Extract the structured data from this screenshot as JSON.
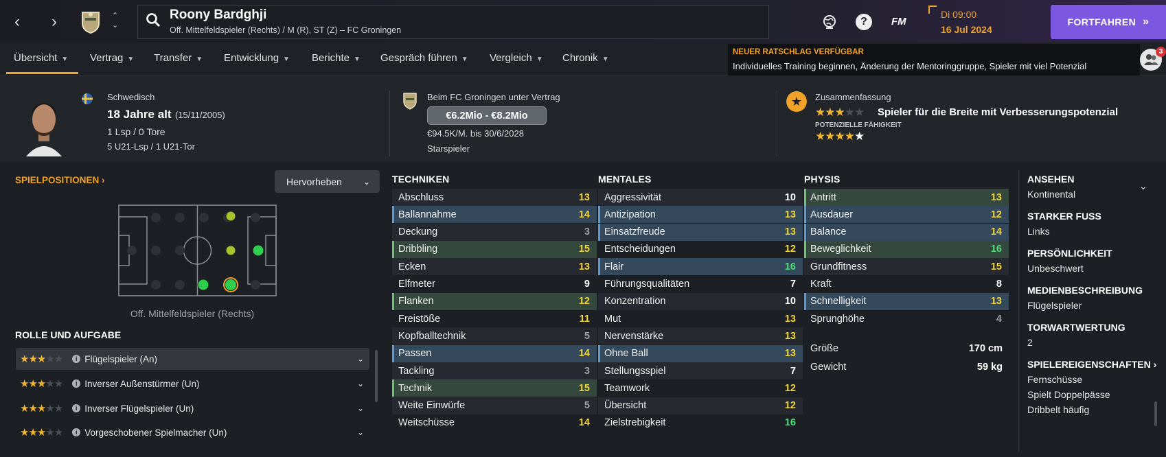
{
  "header": {
    "player_name": "Roony Bardghji",
    "player_subtitle": "Off. Mittelfeldspieler (Rechts) / M (R), ST (Z) – FC Groningen",
    "day_time": "Di 09:00",
    "date": "16 Jul 2024",
    "continue_label": "FORTFAHREN",
    "fm_label": "FM"
  },
  "tabs": [
    "Übersicht",
    "Vertrag",
    "Transfer",
    "Entwicklung",
    "Berichte",
    "Gespräch führen",
    "Vergleich",
    "Chronik"
  ],
  "notice": {
    "title": "NEUER RATSCHLAG VERFÜGBAR",
    "text": "Individuelles Training beginnen, Änderung der Mentoringgruppe, Spieler mit viel Potenzial",
    "badge": "3"
  },
  "profile": {
    "nationality": "Schwedisch",
    "age": "18 Jahre alt",
    "dob": "(15/11/2005)",
    "caps": "1 Lsp / 0 Tore",
    "youth_caps": "5 U21-Lsp / 1 U21-Tor"
  },
  "contract": {
    "club_line": "Beim FC Groningen unter Vertrag",
    "value": "€6.2Mio - €8.2Mio",
    "wage": "€94.5K/M. bis 30/6/2028",
    "status": "Starspieler"
  },
  "summary": {
    "title": "Zusammenfassung",
    "description": "Spieler für die Breite mit Verbesserungspotenzial",
    "potential_label": "POTENZIELLE FÄHIGKEIT",
    "current_stars": 3,
    "potential_stars": 4
  },
  "positions": {
    "title": "SPIELPOSITIONEN",
    "highlight_label": "Hervorheben",
    "caption": "Off. Mittelfeldspieler (Rechts)",
    "role_title": "ROLLE UND AUFGABE",
    "roles": [
      {
        "stars": 3,
        "label": "Flügelspieler (An)"
      },
      {
        "stars": 3,
        "label": "Inverser Außenstürmer (Un)"
      },
      {
        "stars": 3,
        "label": "Inverser Flügelspieler (Un)"
      },
      {
        "stars": 3,
        "label": "Vorgeschobener Spielmacher (Un)"
      }
    ]
  },
  "attributes": {
    "techniken_title": "TECHNIKEN",
    "mentales_title": "MENTALES",
    "physis_title": "PHYSIS",
    "techniken": [
      {
        "name": "Abschluss",
        "value": "13"
      },
      {
        "name": "Ballannahme",
        "value": "14"
      },
      {
        "name": "Deckung",
        "value": "3"
      },
      {
        "name": "Dribbling",
        "value": "15"
      },
      {
        "name": "Ecken",
        "value": "13"
      },
      {
        "name": "Elfmeter",
        "value": "9"
      },
      {
        "name": "Flanken",
        "value": "12"
      },
      {
        "name": "Freistöße",
        "value": "11"
      },
      {
        "name": "Kopfballtechnik",
        "value": "5"
      },
      {
        "name": "Passen",
        "value": "14"
      },
      {
        "name": "Tackling",
        "value": "3"
      },
      {
        "name": "Technik",
        "value": "15"
      },
      {
        "name": "Weite Einwürfe",
        "value": "5"
      },
      {
        "name": "Weitschüsse",
        "value": "14"
      }
    ],
    "mentales": [
      {
        "name": "Aggressivität",
        "value": "10"
      },
      {
        "name": "Antizipation",
        "value": "13"
      },
      {
        "name": "Einsatzfreude",
        "value": "13"
      },
      {
        "name": "Entscheidungen",
        "value": "12"
      },
      {
        "name": "Flair",
        "value": "16"
      },
      {
        "name": "Führungsqualitäten",
        "value": "7"
      },
      {
        "name": "Konzentration",
        "value": "10"
      },
      {
        "name": "Mut",
        "value": "13"
      },
      {
        "name": "Nervenstärke",
        "value": "13"
      },
      {
        "name": "Ohne Ball",
        "value": "13"
      },
      {
        "name": "Stellungsspiel",
        "value": "7"
      },
      {
        "name": "Teamwork",
        "value": "12"
      },
      {
        "name": "Übersicht",
        "value": "12"
      },
      {
        "name": "Zielstrebigkeit",
        "value": "16"
      }
    ],
    "physis": [
      {
        "name": "Antritt",
        "value": "13"
      },
      {
        "name": "Ausdauer",
        "value": "12"
      },
      {
        "name": "Balance",
        "value": "14"
      },
      {
        "name": "Beweglichkeit",
        "value": "16"
      },
      {
        "name": "Grundfitness",
        "value": "15"
      },
      {
        "name": "Kraft",
        "value": "8"
      },
      {
        "name": "Schnelligkeit",
        "value": "13"
      },
      {
        "name": "Sprunghöhe",
        "value": "4"
      }
    ],
    "height_label": "Größe",
    "height": "170 cm",
    "weight_label": "Gewicht",
    "weight": "59 kg"
  },
  "side": {
    "ansehen_label": "ANSEHEN",
    "ansehen": "Kontinental",
    "fuss_label": "STARKER FUSS",
    "fuss": "Links",
    "pers_label": "PERSÖNLICHKEIT",
    "pers": "Unbeschwert",
    "medien_label": "MEDIENBESCHREIBUNG",
    "medien": "Flügelspieler",
    "torwart_label": "TORWARTWERTUNG",
    "torwart": "2",
    "traits_label": "SPIELEREIGENSCHAFTEN",
    "traits": [
      "Fernschüsse",
      "Spielt Doppelpässe",
      "Dribbelt häufig"
    ]
  },
  "colors": {
    "accent": "#f0a229",
    "continue": "#7c57e0",
    "value_yellow": "#f3d53c",
    "value_green": "#4fe07a",
    "value_grey": "#9aa0a6",
    "highlight_blue": "#34495c",
    "highlight_green": "#34483e"
  }
}
